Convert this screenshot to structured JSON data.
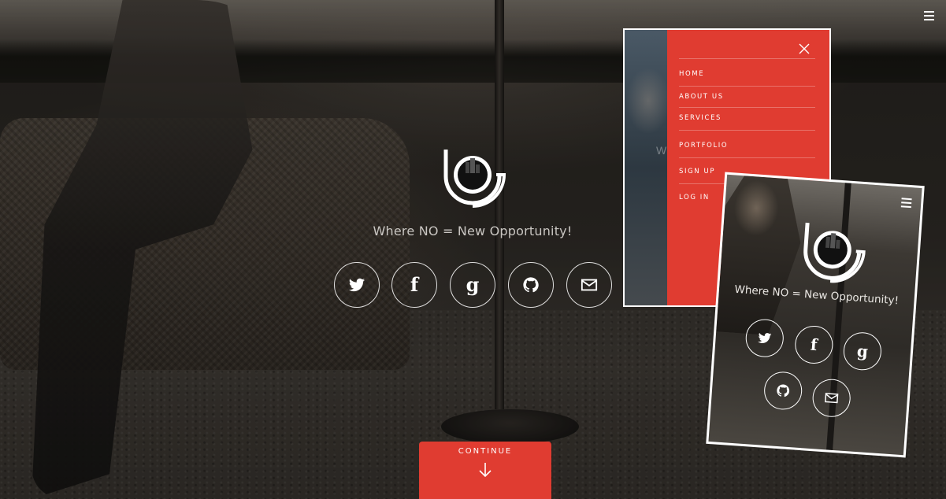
{
  "hero": {
    "tagline": "Where NO = New Opportunity!",
    "continue_label": "CONTINUE"
  },
  "social_icons": [
    "twitter-icon",
    "facebook-icon",
    "google-icon",
    "github-icon",
    "email-icon"
  ],
  "social_glyphs": {
    "facebook": "f",
    "google": "g"
  },
  "tablet_menu": {
    "items": [
      "HOME",
      "ABOUT US",
      "SERVICES",
      "PORTFOLIO",
      "SIGN UP",
      "LOG IN"
    ],
    "ghost_text": "W"
  },
  "phone_mockup": {
    "tagline": "Where NO = New Opportunity!"
  },
  "colors": {
    "accent": "#e03c31",
    "text": "#ffffff",
    "tagline": "#c9c6c2"
  }
}
